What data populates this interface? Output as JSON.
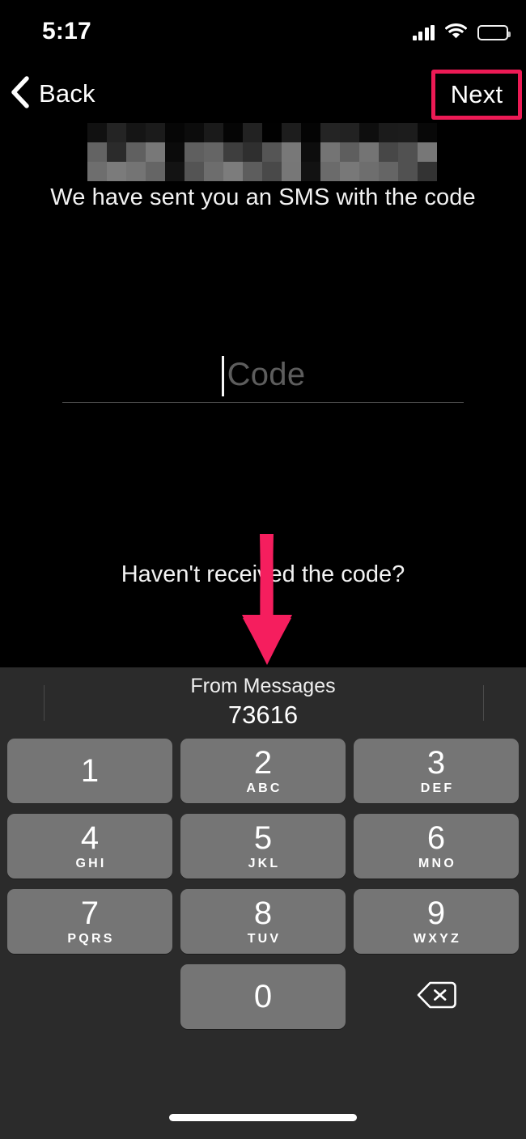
{
  "status_bar": {
    "time": "5:17",
    "cellular_icon": "cellular-signal-icon",
    "wifi_icon": "wifi-icon",
    "battery_icon": "battery-icon"
  },
  "nav_bar": {
    "back_label": "Back",
    "back_icon": "chevron-left-icon",
    "next_label": "Next",
    "next_highlight_color": "#ec1a55"
  },
  "content": {
    "title_redacted": "",
    "subtitle": "We have sent you an SMS with the code",
    "code_input": {
      "value": "",
      "placeholder": "Code"
    },
    "resend_prompt": "Haven't received the code?"
  },
  "annotation": {
    "arrow_color": "#f51e5e",
    "arrow_direction": "down",
    "points_to": "suggestion-bar"
  },
  "keyboard": {
    "suggestion": {
      "source_label": "From Messages",
      "value": "73616"
    },
    "rows": [
      [
        {
          "digit": "1",
          "letters": ""
        },
        {
          "digit": "2",
          "letters": "ABC"
        },
        {
          "digit": "3",
          "letters": "DEF"
        }
      ],
      [
        {
          "digit": "4",
          "letters": "GHI"
        },
        {
          "digit": "5",
          "letters": "JKL"
        },
        {
          "digit": "6",
          "letters": "MNO"
        }
      ],
      [
        {
          "digit": "7",
          "letters": "PQRS"
        },
        {
          "digit": "8",
          "letters": "TUV"
        },
        {
          "digit": "9",
          "letters": "WXYZ"
        }
      ],
      [
        {
          "digit": "0",
          "letters": ""
        }
      ]
    ],
    "backspace_icon": "backspace-icon",
    "key_color": "#757575",
    "background_color": "#2b2b2b"
  },
  "home_indicator": "home-indicator"
}
